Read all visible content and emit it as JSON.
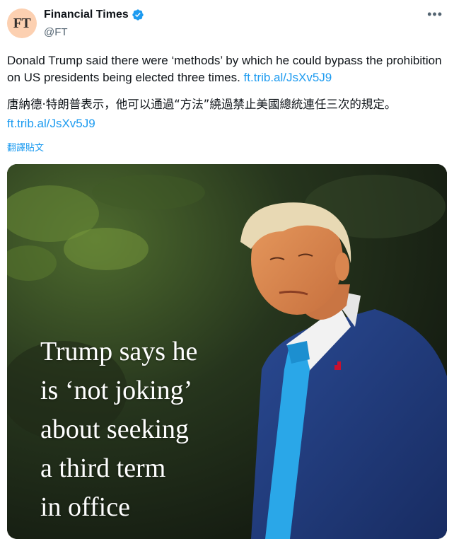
{
  "account": {
    "avatar_text": "FT",
    "display_name": "Financial Times",
    "handle": "@FT",
    "verified_icon": "verified-badge-icon",
    "more_icon": "more-options-icon"
  },
  "post": {
    "text": "Donald Trump said there were ‘methods’ by which he could bypass the prohibition on US presidents being elected three times.",
    "link": "ft.trib.al/JsXv5J9",
    "translated_text": "唐納德·特朗普表示，他可以通過“方法”繞過禁止美國總統連任三次的規定。",
    "translated_link": "ft.trib.al/JsXv5J9",
    "translate_label": "翻譯貼文"
  },
  "media": {
    "headline_lines": [
      "Trump says he",
      "is ‘not joking’",
      "about seeking",
      "a third term",
      "in office"
    ]
  },
  "colors": {
    "link": "#1d9bf0",
    "avatar_bg": "#fcd0b1",
    "suit": "#1f3a7a",
    "tie": "#2aa7e8"
  }
}
